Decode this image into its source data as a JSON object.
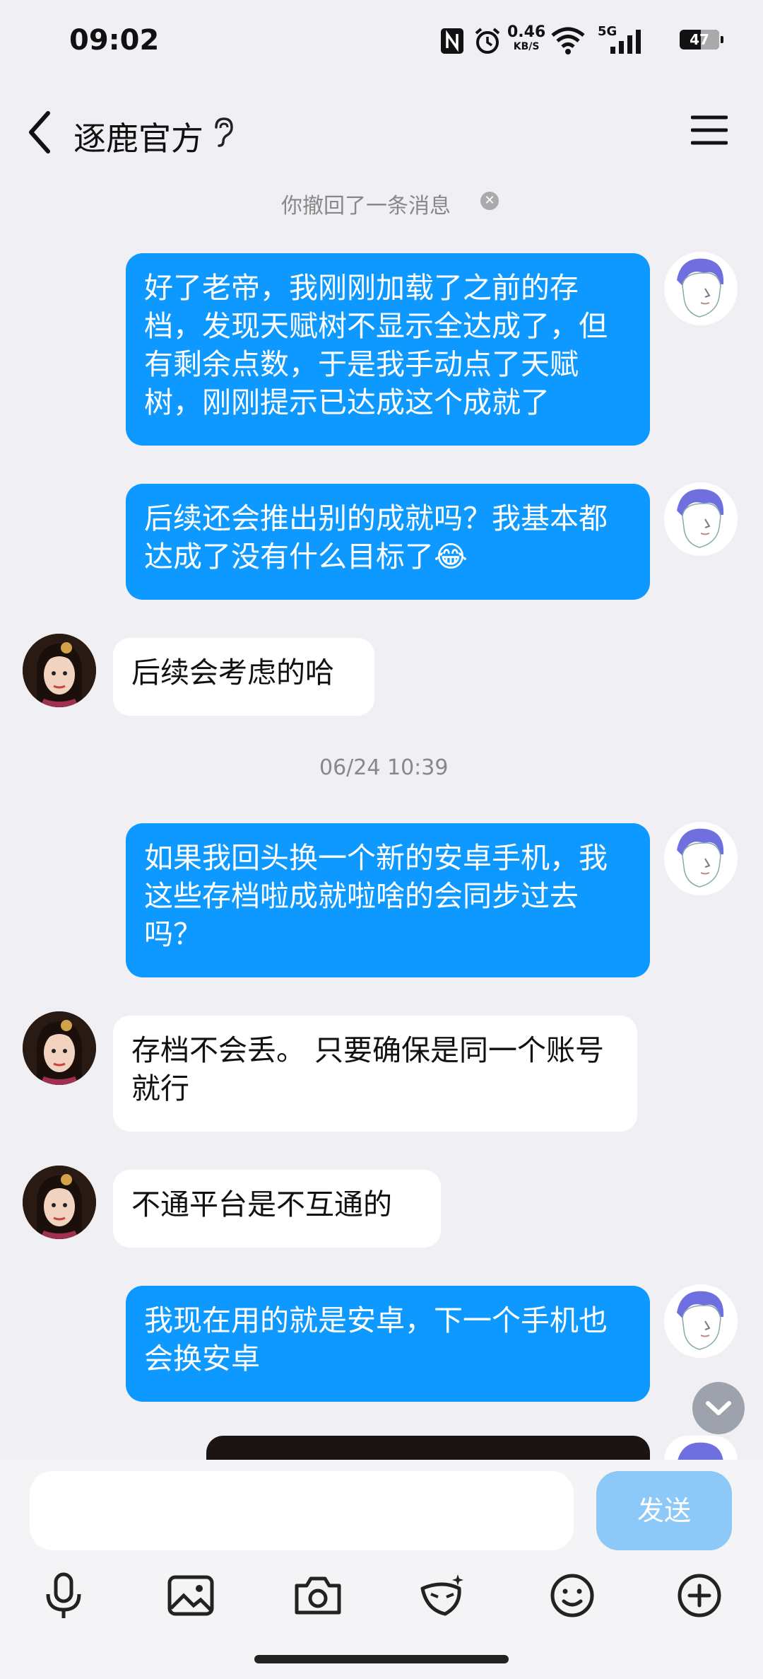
{
  "status_bar": {
    "time": "09:02",
    "net_speed": "0.46",
    "net_unit": "KB/S",
    "network": "5G",
    "battery": "47"
  },
  "nav": {
    "title": "逐鹿官方"
  },
  "system_note": "你撤回了一条消息",
  "time_note": "06/24 10:39",
  "messages": [
    {
      "side": "out",
      "text": "好了老帝，我刚刚加载了之前的存档，发现天赋树不显示全达成了，但有剩余点数，于是我手动点了天赋树，刚刚提示已达成这个成就了"
    },
    {
      "side": "out",
      "text": "后续还会推出别的成就吗？我基本都达成了没有什么目标了😂"
    },
    {
      "side": "in",
      "text": "后续会考虑的哈"
    },
    {
      "side": "out",
      "text": "如果我回头换一个新的安卓手机，我这些存档啦成就啦啥的会同步过去吗？"
    },
    {
      "side": "in",
      "text": "存档不会丢。 只要确保是同一个账号就行"
    },
    {
      "side": "in",
      "text": "不通平台是不互通的"
    },
    {
      "side": "out",
      "text": "我现在用的就是安卓，下一个手机也会换安卓"
    }
  ],
  "input": {
    "value": "",
    "placeholder": ""
  },
  "send_label": "发送",
  "colors": {
    "out_bubble": "#0d99ff",
    "in_bubble": "#ffffff",
    "send_disabled": "#8dc9f8",
    "background": "#f0f0f4"
  }
}
